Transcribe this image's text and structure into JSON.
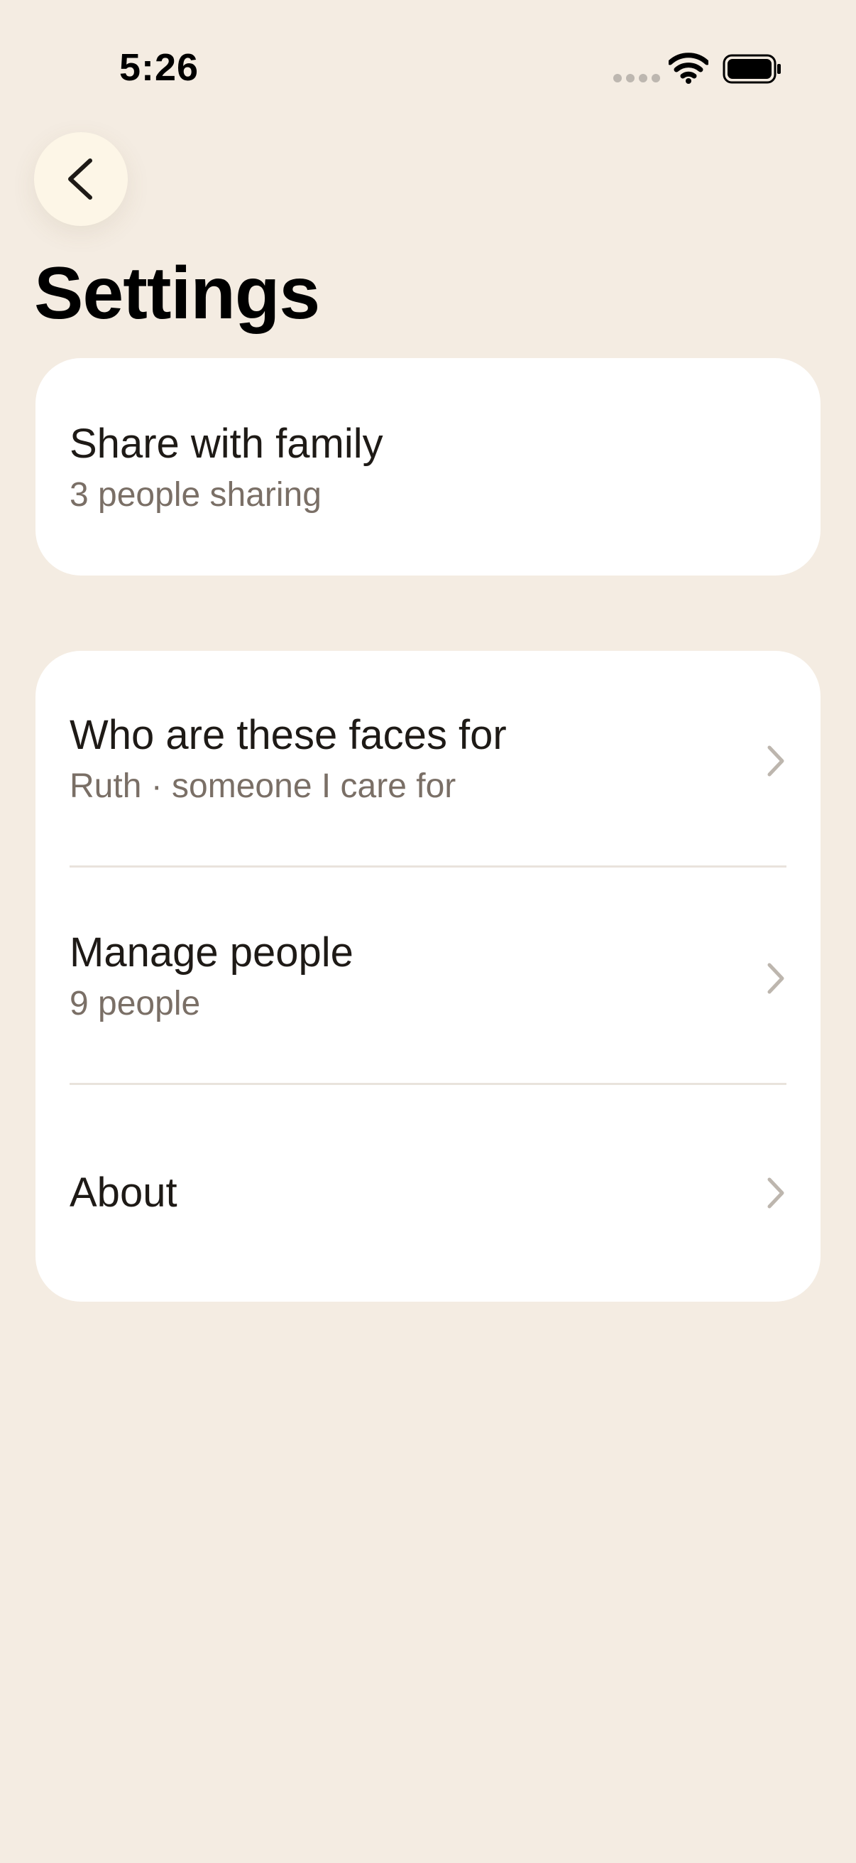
{
  "status_bar": {
    "time": "5:26"
  },
  "header": {
    "back_icon": "chevron-left-icon",
    "title": "Settings"
  },
  "sharing_card": {
    "title": "Share with family",
    "subtitle": "3 people sharing"
  },
  "settings_list": [
    {
      "title": "Who are these faces for",
      "subtitle": "Ruth · someone I care for",
      "icon": "chevron-right-icon"
    },
    {
      "title": "Manage people",
      "subtitle": "9 people",
      "icon": "chevron-right-icon"
    },
    {
      "title": "About",
      "icon": "chevron-right-icon"
    }
  ],
  "colors": {
    "background": "#F4ECE2",
    "card": "#FFFFFF",
    "back_button": "#FDF6E7",
    "primary_text": "#1E1A16",
    "secondary_text": "#7A6F66",
    "chevron": "#BDB6AE",
    "divider": "#E9E3DC"
  }
}
